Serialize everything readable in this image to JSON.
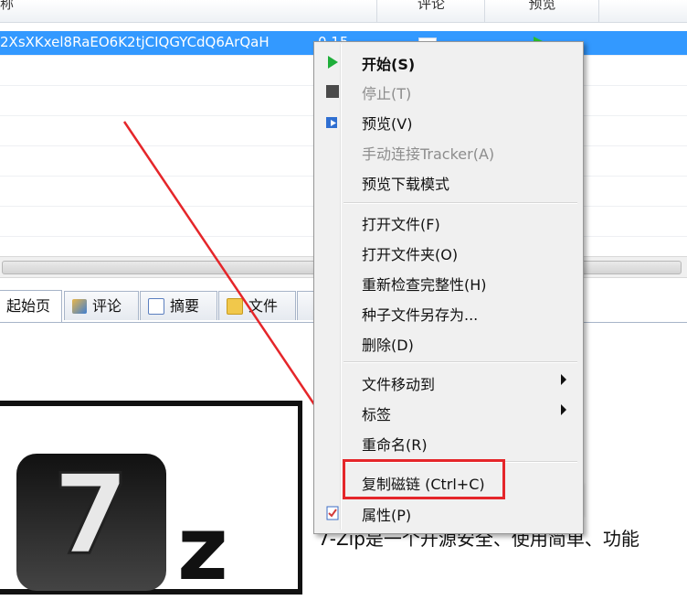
{
  "list": {
    "columns": {
      "name": "称",
      "comment": "评论",
      "preview": "预览"
    },
    "selected_row": {
      "name": "2XsXKxel8RaEO6K2tjCIQGYCdQ6ArQaH",
      "size": "0.15"
    }
  },
  "tabs": [
    {
      "label": "起始页",
      "icon": "home-icon"
    },
    {
      "label": "评论",
      "icon": "comment-icon"
    },
    {
      "label": "摘要",
      "icon": "summary-icon"
    },
    {
      "label": "文件",
      "icon": "file-icon"
    }
  ],
  "content": {
    "description": "7-Zip是一个开源安全、使用简单、功能",
    "logo_seven": "7",
    "logo_z": "z",
    "side_mark": ":"
  },
  "menu": {
    "items": [
      {
        "label": "开始(S)",
        "icon": "play-icon",
        "bold": true,
        "disabled": false
      },
      {
        "label": "停止(T)",
        "icon": "stop-icon",
        "disabled": true
      },
      {
        "label": "预览(V)",
        "icon": "preview-icon",
        "disabled": false
      },
      {
        "label": "手动连接Tracker(A)",
        "disabled": true
      },
      {
        "label": "预览下载模式",
        "disabled": false
      },
      {
        "label": "打开文件(F)",
        "disabled": false
      },
      {
        "label": "打开文件夹(O)",
        "disabled": false
      },
      {
        "label": "重新检查完整性(H)",
        "disabled": false
      },
      {
        "label": "种子文件另存为...",
        "disabled": false
      },
      {
        "label": "删除(D)",
        "disabled": false
      },
      {
        "label": "文件移动到",
        "submenu": true,
        "disabled": false
      },
      {
        "label": "标签",
        "submenu": true,
        "disabled": false
      },
      {
        "label": "重命名(R)",
        "disabled": false
      },
      {
        "label": "复制磁链 (Ctrl+C)",
        "highlighted": true,
        "disabled": false
      },
      {
        "label": "属性(P)",
        "icon": "properties-icon",
        "disabled": false
      }
    ]
  },
  "colors": {
    "selection": "#3399ff",
    "highlight_box": "#e5262a",
    "arrow": "#e5262a"
  }
}
